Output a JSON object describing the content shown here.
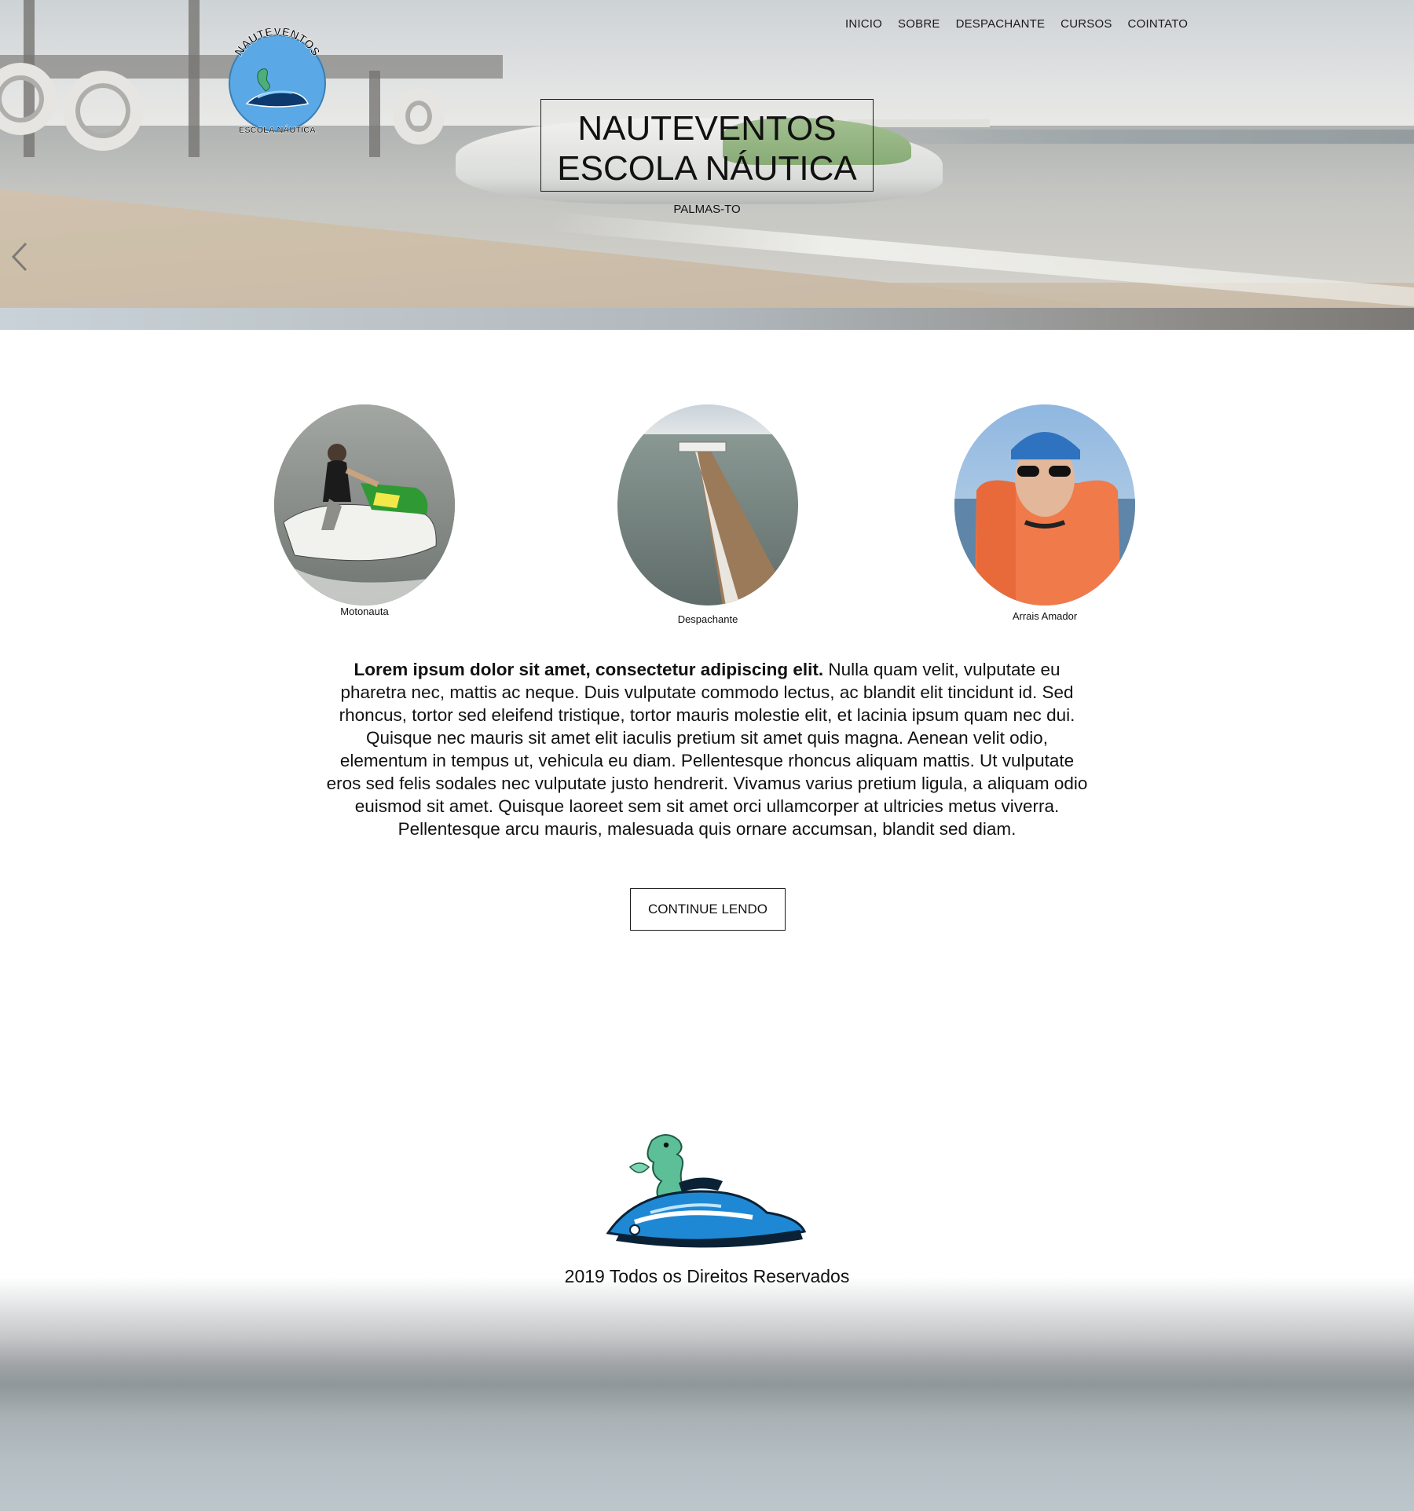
{
  "brand": {
    "logo_top_text": "NAUTEVENTOS",
    "logo_bottom_text": "ESCOLA NÁUTICA",
    "accent_color": "#5aa9e6"
  },
  "nav": {
    "items": [
      {
        "label": "INICIO"
      },
      {
        "label": "SOBRE"
      },
      {
        "label": "DESPACHANTE"
      },
      {
        "label": "CURSOS"
      },
      {
        "label": "COINTATO"
      }
    ]
  },
  "hero": {
    "title_line1": "NAUTEVENTOS",
    "title_line2": "ESCOLA NÁUTICA",
    "subtitle": "PALMAS-TO",
    "prev_arrow_icon": "chevron-left-icon"
  },
  "cards": [
    {
      "label": "Motonauta",
      "image": "jetski-rider-photo"
    },
    {
      "label": "Despachante",
      "image": "pier-photo"
    },
    {
      "label": "Arrais Amador",
      "image": "instructor-photo"
    }
  ],
  "about": {
    "lead": "Lorem ipsum dolor sit amet, consectetur adipiscing elit.",
    "body": " Nulla quam velit, vulputate eu pharetra nec, mattis ac neque. Duis vulputate commodo lectus, ac blandit elit tincidunt id. Sed rhoncus, tortor sed eleifend tristique, tortor mauris molestie elit, et lacinia ipsum quam nec dui. Quisque nec mauris sit amet elit iaculis pretium sit amet quis magna. Aenean velit odio, elementum in tempus ut, vehicula eu diam. Pellentesque rhoncus aliquam mattis. Ut vulputate eros sed felis sodales nec vulputate justo hendrerit. Vivamus varius pretium ligula, a aliquam odio euismod sit amet. Quisque laoreet sem sit amet orci ullamcorper at ultricies metus viverra. Pellentesque arcu mauris, malesuada quis ornare accumsan, blandit sed diam.",
    "button_label": "CONTINUE LENDO"
  },
  "footer": {
    "mascot_icon": "seahorse-jetski-icon",
    "copyright": "2019 Todos os Direitos Reservados"
  }
}
